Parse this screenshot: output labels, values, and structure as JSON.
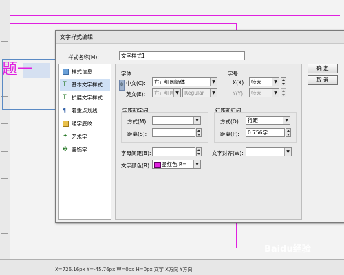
{
  "background": {
    "heading_text": "题一",
    "status_text": "X=726.16px Y=-45.76px    W=0px H=0px    文字 X方向 Y方向",
    "watermark": "Baidu经验"
  },
  "dialog": {
    "title": "文字样式编辑",
    "style_name_label": "样式名称(M):",
    "style_name_value": "文字样式1",
    "ok_label": "确 定",
    "cancel_label": "取 消",
    "nav_items": [
      {
        "label": "样式信息",
        "icon": "info-icon"
      },
      {
        "label": "基本文字样式",
        "icon": "basic-style-icon"
      },
      {
        "label": "扩展文字样式",
        "icon": "extended-style-icon"
      },
      {
        "label": "着重点划线",
        "icon": "emphasis-icon"
      },
      {
        "label": "通字底纹",
        "icon": "shading-icon"
      },
      {
        "label": "艺术字",
        "icon": "art-text-icon"
      },
      {
        "label": "装饰字",
        "icon": "decorative-text-icon"
      }
    ],
    "font": {
      "group_label": "字体",
      "chinese_label": "中文(C):",
      "chinese_value": "方正细圆简体",
      "western_label": "英文(E):",
      "western_value": "方正细园",
      "western_style": "Regular"
    },
    "size": {
      "group_label": "字号",
      "x_label": "X(X):",
      "x_value": "特大",
      "y_label": "Y(Y):",
      "y_value": "特大"
    },
    "char_spacing": {
      "group_label": "字距和字间",
      "mode_label": "方式(M):",
      "mode_value": "",
      "distance_label": "距离(S):",
      "distance_value": ""
    },
    "line_spacing": {
      "group_label": "行距和行间",
      "mode_label": "方式(O):",
      "mode_value": "行距",
      "distance_label": "距离(P):",
      "distance_value": "0.756字"
    },
    "letter_spacing_label": "字母间距(B):",
    "letter_spacing_value": "",
    "text_align_label": "文字对齐(W):",
    "text_align_value": "",
    "text_color_label": "文字颜色(R):",
    "text_color_value": "品红色 R=",
    "colors": {
      "magenta": "#e020e0",
      "active_nav": "#cfe0f5"
    }
  }
}
